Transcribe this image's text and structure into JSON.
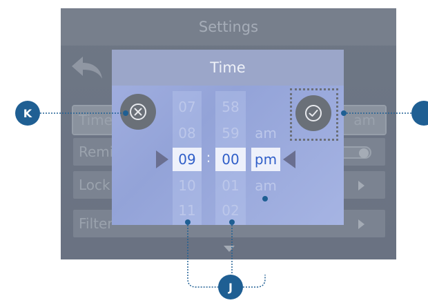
{
  "screen": {
    "title": "Settings",
    "menu": [
      {
        "label": "Time",
        "value": "am",
        "kind": "value"
      },
      {
        "label": "Reminders",
        "kind": "toggle",
        "on": true
      },
      {
        "label": "Lock",
        "kind": "arrow"
      },
      {
        "label": "Filter",
        "kind": "arrow"
      }
    ]
  },
  "dialog": {
    "title": "Time",
    "hours": [
      "07",
      "08",
      "09",
      "10",
      "11"
    ],
    "minutes": [
      "58",
      "59",
      "00",
      "01",
      "02"
    ],
    "colon": ":",
    "ampm": [
      "am",
      "pm",
      "am"
    ],
    "selected": {
      "hour": "09",
      "minute": "00",
      "ampm": "pm"
    }
  },
  "callouts": {
    "k": "K",
    "j": "J",
    "right": ""
  },
  "colors": {
    "callout": "#1f5f93",
    "dialog_bg": "#9eaddf",
    "selected_text": "#2f5ec8"
  },
  "icons": {
    "back": "back-arrow-icon",
    "cancel": "close-circle-icon",
    "confirm": "check-circle-icon",
    "scroll": "chevron-down-icon"
  }
}
